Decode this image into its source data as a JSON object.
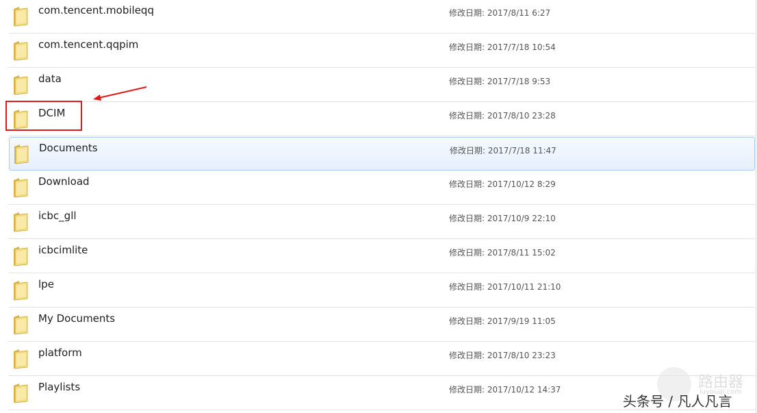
{
  "date_label": "修改日期:",
  "items": [
    {
      "name": "com.tencent.mobileqq",
      "date": "2017/8/11 6:27"
    },
    {
      "name": "com.tencent.qqpim",
      "date": "2017/7/18 10:54"
    },
    {
      "name": "data",
      "date": "2017/7/18 9:53"
    },
    {
      "name": "DCIM",
      "date": "2017/8/10 23:28",
      "highlighted": true
    },
    {
      "name": "Documents",
      "date": "2017/7/18 11:47",
      "selected": true
    },
    {
      "name": "Download",
      "date": "2017/10/12 8:29"
    },
    {
      "name": "icbc_gll",
      "date": "2017/10/9 22:10"
    },
    {
      "name": "icbcimlite",
      "date": "2017/8/11 15:02"
    },
    {
      "name": "lpe",
      "date": "2017/10/11 21:10"
    },
    {
      "name": "My Documents",
      "date": "2017/9/19 11:05"
    },
    {
      "name": "platform",
      "date": "2017/8/10 23:23"
    },
    {
      "name": "Playlists",
      "date": "2017/10/12 14:37"
    }
  ],
  "annotation_color": "#e01818",
  "watermark": {
    "site": "路由器",
    "url": "luyouqi.com",
    "author": "头条号 / 凡人凡言"
  }
}
